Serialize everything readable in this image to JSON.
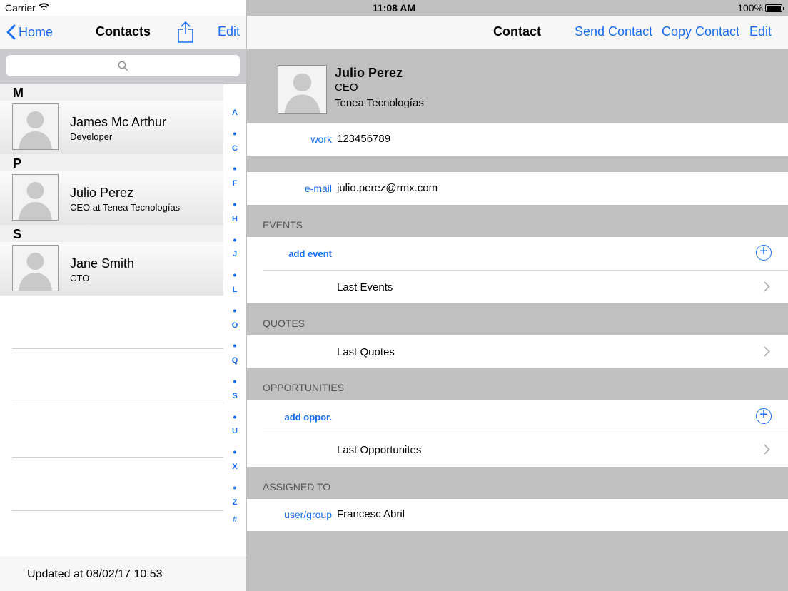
{
  "status": {
    "carrier": "Carrier",
    "time": "11:08 AM",
    "battery": "100%"
  },
  "left_nav": {
    "back_label": "Home",
    "title": "Contacts",
    "edit_label": "Edit"
  },
  "search": {
    "placeholder": ""
  },
  "sections": [
    {
      "letter": "M",
      "contacts": [
        {
          "name": "James Mc Arthur",
          "subtitle": "Developer"
        }
      ]
    },
    {
      "letter": "P",
      "contacts": [
        {
          "name": "Julio Perez",
          "subtitle": "CEO at Tenea Tecnologías"
        }
      ]
    },
    {
      "letter": "S",
      "contacts": [
        {
          "name": "Jane Smith",
          "subtitle": "CTO"
        }
      ]
    }
  ],
  "index": [
    "A",
    "•",
    "C",
    "•",
    "F",
    "•",
    "H",
    "•",
    "J",
    "•",
    "L",
    "•",
    "O",
    "•",
    "Q",
    "•",
    "S",
    "•",
    "U",
    "•",
    "X",
    "•",
    "Z",
    "#"
  ],
  "footer": {
    "updated": "Updated at 08/02/17 10:53"
  },
  "right_nav": {
    "title": "Contact",
    "send_label": "Send Contact",
    "copy_label": "Copy Contact",
    "edit_label": "Edit"
  },
  "contact": {
    "name": "Julio Perez",
    "title": "CEO",
    "company": "Tenea Tecnologías"
  },
  "fields": {
    "work_label": "work",
    "work_value": "123456789",
    "email_label": "e-mail",
    "email_value": "julio.perez@rmx.com"
  },
  "events": {
    "header": "EVENTS",
    "add_label": "add event",
    "last_label": "Last Events"
  },
  "quotes": {
    "header": "QUOTES",
    "last_label": "Last Quotes"
  },
  "opportunities": {
    "header": "OPPORTUNITIES",
    "add_label": "add oppor.",
    "last_label": "Last Opportunites"
  },
  "assigned": {
    "header": "ASSIGNED TO",
    "label": "user/group",
    "value": "Francesc Abril"
  },
  "colors": {
    "accent": "#1a6ef0",
    "section_bg": "#c0c0c0"
  }
}
